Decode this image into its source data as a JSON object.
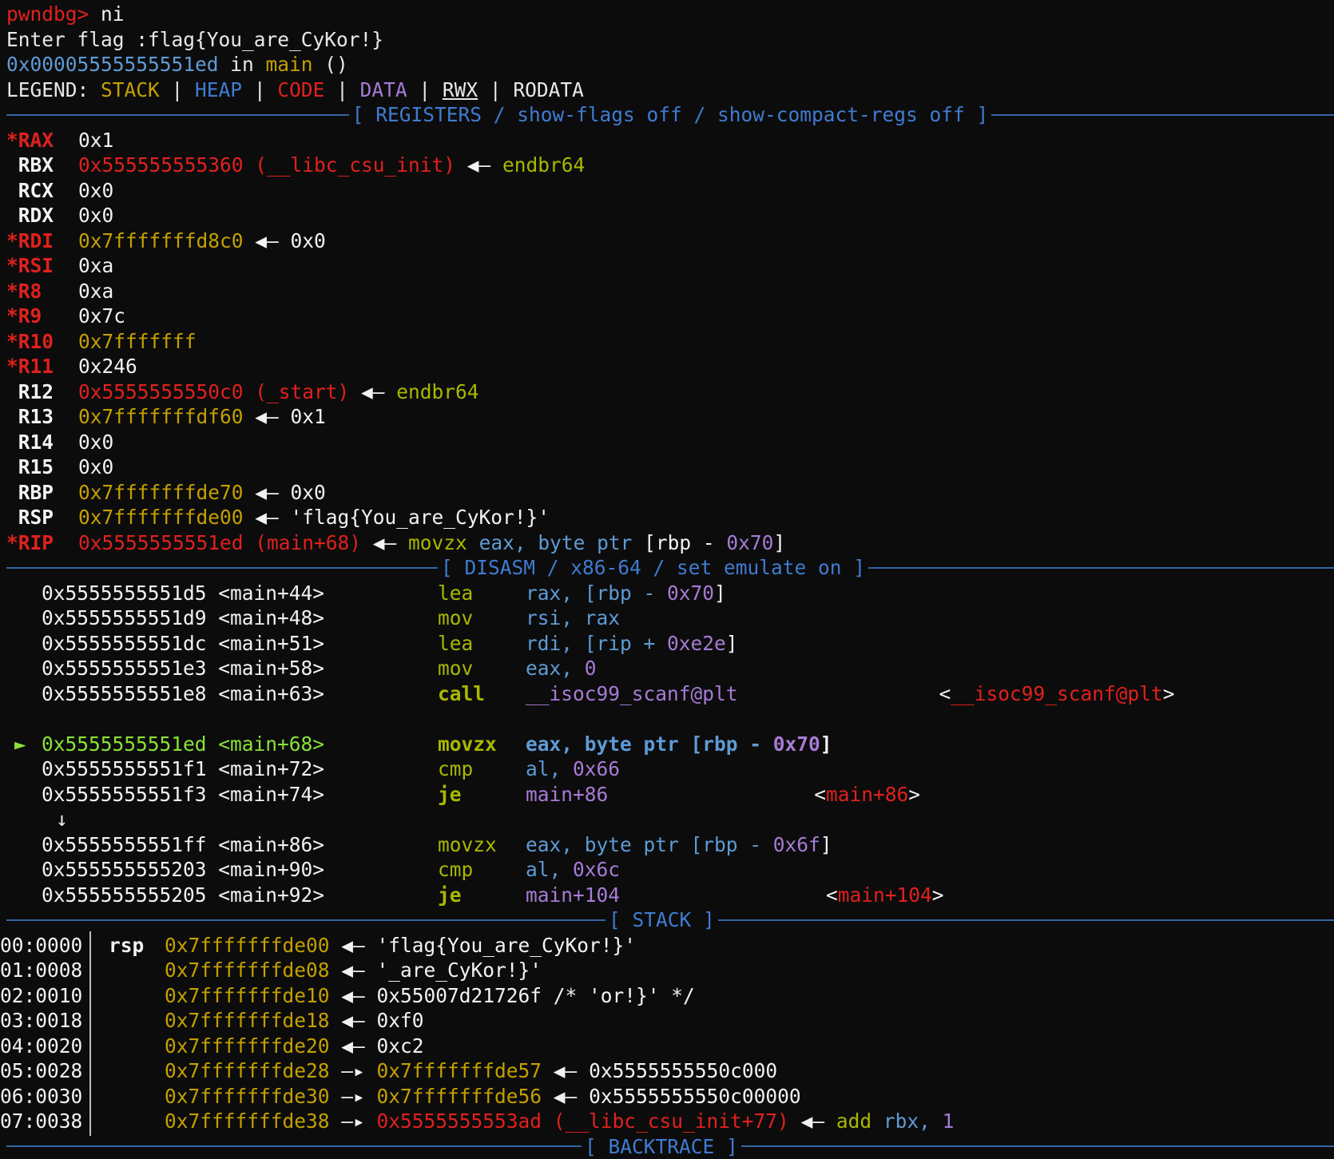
{
  "top": {
    "prompt": "pwndbg>",
    "command": " ni",
    "input_line": "Enter flag :flag{You_are_CyKor!}",
    "loc_addr": "0x00005555555551ed",
    "loc_in": " in ",
    "loc_func": "main",
    "loc_tail": " ()"
  },
  "legend": {
    "label": "LEGEND: ",
    "stack": "STACK",
    "heap": "HEAP",
    "code": "CODE",
    "data": "DATA",
    "rwx": "RWX",
    "rodata": "RODATA",
    "pipe": " | "
  },
  "headers": {
    "registers": "[ REGISTERS / show-flags off / show-compact-regs off ]",
    "disasm": "[ DISASM / x86-64 / set emulate on ]",
    "stack": "[ STACK ]",
    "backtrace": "[ BACKTRACE ]"
  },
  "registers": [
    {
      "name": "*RAX",
      "val": "0x1"
    },
    {
      "name": " RBX",
      "val": "0x555555555360",
      "sym": " (__libc_csu_init)",
      "arrow": " ◀— ",
      "deref": "endbr64"
    },
    {
      "name": " RCX",
      "val": "0x0"
    },
    {
      "name": " RDX",
      "val": "0x0"
    },
    {
      "name": "*RDI",
      "val": "0x7fffffffd8c0",
      "arrow": " ◀— ",
      "deref": "0x0"
    },
    {
      "name": "*RSI",
      "val": "0xa"
    },
    {
      "name": "*R8",
      "val": "0xa"
    },
    {
      "name": "*R9",
      "val": "0x7c"
    },
    {
      "name": "*R10",
      "val": "0x7fffffff"
    },
    {
      "name": "*R11",
      "val": "0x246"
    },
    {
      "name": " R12",
      "val": "0x5555555550c0",
      "sym": " (_start)",
      "arrow": " ◀— ",
      "deref": "endbr64"
    },
    {
      "name": " R13",
      "val": "0x7fffffffdf60",
      "arrow": " ◀— ",
      "deref": "0x1"
    },
    {
      "name": " R14",
      "val": "0x0"
    },
    {
      "name": " R15",
      "val": "0x0"
    },
    {
      "name": " RBP",
      "val": "0x7fffffffde70",
      "arrow": " ◀— ",
      "deref": "0x0"
    },
    {
      "name": " RSP",
      "val": "0x7fffffffde00",
      "arrow": " ◀— ",
      "deref": "'flag{You_are_CyKor!}'"
    },
    {
      "name": "*RIP",
      "val": "0x5555555551ed",
      "sym": " (main+68)",
      "arrow": " ◀— ",
      "i_mn": "movzx ",
      "i_a": "eax, ",
      "i_b": "byte ptr ",
      "i_c": "[rbp - ",
      "i_d": "0x70",
      "i_e": "]"
    }
  ],
  "disasm": [
    {
      "addr": "0x5555555551d5",
      "sym": "<main+44>",
      "mn": "lea",
      "o1": "rax, [rbp - ",
      "o2": "0x70",
      "o3": "]"
    },
    {
      "addr": "0x5555555551d9",
      "sym": "<main+48>",
      "mn": "mov",
      "o1": "rsi, rax"
    },
    {
      "addr": "0x5555555551dc",
      "sym": "<main+51>",
      "mn": "lea",
      "o1": "rdi, [rip + ",
      "o2": "0xe2e",
      "o3": "]"
    },
    {
      "addr": "0x5555555551e3",
      "sym": "<main+58>",
      "mn": "mov",
      "o1": "eax, ",
      "o2": "0"
    },
    {
      "addr": "0x5555555551e8",
      "sym": "<main+63>",
      "mn": "call",
      "o1": "__isoc99_scanf@plt",
      "target": "__isoc99_scanf@plt"
    },
    {
      "addr": "0x5555555551ed",
      "sym": "<main+68>",
      "mn": "movzx",
      "o1": "eax, byte ptr [rbp - ",
      "o2": "0x70",
      "o3": "]",
      "current": true,
      "marker": "►"
    },
    {
      "addr": "0x5555555551f1",
      "sym": "<main+72>",
      "mn": "cmp",
      "o1": "al, ",
      "o2": "0x66"
    },
    {
      "addr": "0x5555555551f3",
      "sym": "<main+74>",
      "mn": "je",
      "o1": "main+86",
      "target": "main+86"
    },
    {
      "addr": "0x5555555551ff",
      "sym": "<main+86>",
      "mn": "movzx",
      "o1": "eax, byte ptr [rbp - ",
      "o2": "0x6f",
      "o3": "]"
    },
    {
      "addr": "0x555555555203",
      "sym": "<main+90>",
      "mn": "cmp",
      "o1": "al, ",
      "o2": "0x6c"
    },
    {
      "addr": "0x555555555205",
      "sym": "<main+92>",
      "mn": "je",
      "o1": "main+104",
      "target": "main+104"
    }
  ],
  "jump_arrow": "↓",
  "stack": [
    {
      "idx": "00:0000",
      "reg": "rsp",
      "addr": "0x7fffffffde00",
      "a1": " ◀— ",
      "v1": "'flag{You_are_CyKor!}'"
    },
    {
      "idx": "01:0008",
      "reg": "",
      "addr": "0x7fffffffde08",
      "a1": " ◀— ",
      "v1": "'_are_CyKor!}'"
    },
    {
      "idx": "02:0010",
      "reg": "",
      "addr": "0x7fffffffde10",
      "a1": " ◀— ",
      "v1": "0x55007d21726f /* 'or!}' */"
    },
    {
      "idx": "03:0018",
      "reg": "",
      "addr": "0x7fffffffde18",
      "a1": " ◀— ",
      "v1": "0xf0"
    },
    {
      "idx": "04:0020",
      "reg": "",
      "addr": "0x7fffffffde20",
      "a1": " ◀— ",
      "v1": "0xc2"
    },
    {
      "idx": "05:0028",
      "reg": "",
      "addr": "0x7fffffffde28",
      "a1": " —▸ ",
      "v1": "0x7fffffffde57",
      "a2": " ◀— ",
      "v2": "0x5555555550c000"
    },
    {
      "idx": "06:0030",
      "reg": "",
      "addr": "0x7fffffffde30",
      "a1": " —▸ ",
      "v1": "0x7fffffffde56",
      "a2": " ◀— ",
      "v2": "0x5555555550c00000"
    },
    {
      "idx": "07:0038",
      "reg": "",
      "addr": "0x7fffffffde38",
      "a1": " —▸ ",
      "v1": "0x5555555553ad",
      "sym": " (__libc_csu_init+77)",
      "a2": " ◀— ",
      "i1": "add ",
      "i2": "rbx, ",
      "i3": "1"
    }
  ]
}
